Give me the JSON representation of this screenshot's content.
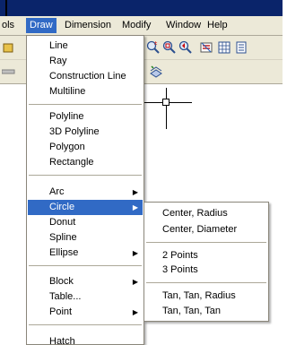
{
  "menubar": {
    "items": [
      "ols",
      "Draw",
      "Dimension",
      "Modify",
      "Window",
      "Help"
    ]
  },
  "draw_menu": {
    "items": [
      {
        "label": "Line"
      },
      {
        "label": "Ray"
      },
      {
        "label": "Construction Line"
      },
      {
        "label": "Multiline"
      },
      {
        "label": "Polyline"
      },
      {
        "label": "3D Polyline"
      },
      {
        "label": "Polygon"
      },
      {
        "label": "Rectangle"
      },
      {
        "label": "Arc"
      },
      {
        "label": "Circle"
      },
      {
        "label": "Donut"
      },
      {
        "label": "Spline"
      },
      {
        "label": "Ellipse"
      },
      {
        "label": "Block"
      },
      {
        "label": "Table..."
      },
      {
        "label": "Point"
      },
      {
        "label": "Hatch"
      }
    ],
    "selected": "Circle"
  },
  "circle_submenu": {
    "items": [
      {
        "label": "Center, Radius"
      },
      {
        "label": "Center, Diameter"
      },
      {
        "label": "2 Points"
      },
      {
        "label": "3 Points"
      },
      {
        "label": "Tan, Tan, Radius"
      },
      {
        "label": "Tan, Tan, Tan"
      }
    ]
  },
  "colors": {
    "menu_highlight": "#316ac5",
    "chrome": "#ece9d8",
    "title_strip": "#0a246a"
  }
}
